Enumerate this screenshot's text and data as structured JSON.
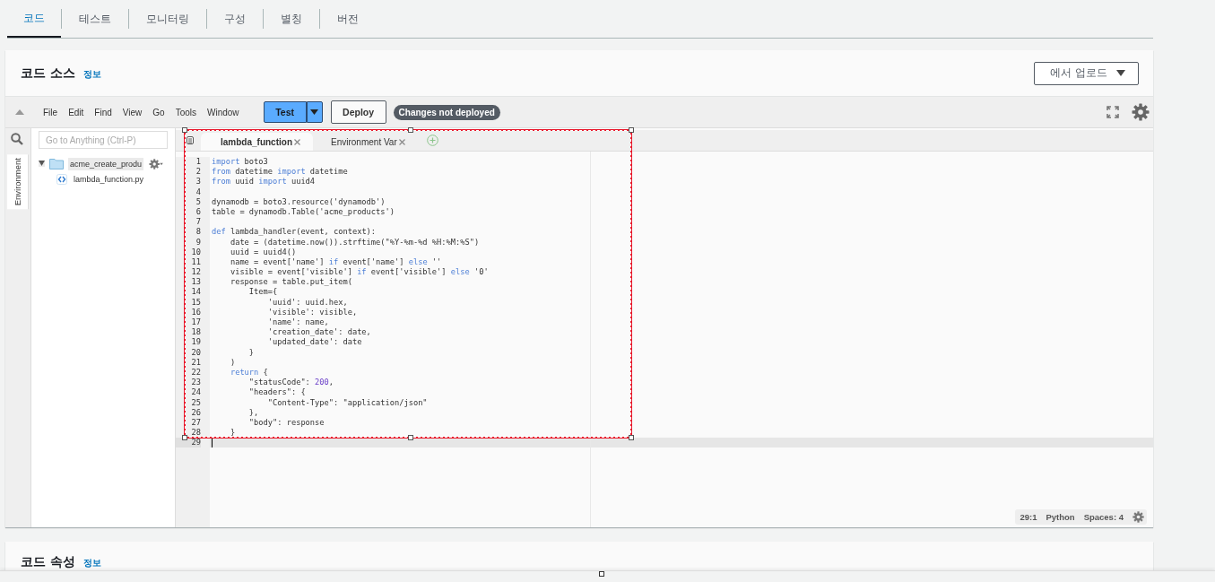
{
  "tabs": [
    {
      "label": "코드",
      "selected": true
    },
    {
      "label": "테스트",
      "selected": false
    },
    {
      "label": "모니터링",
      "selected": false
    },
    {
      "label": "구성",
      "selected": false
    },
    {
      "label": "별칭",
      "selected": false
    },
    {
      "label": "버전",
      "selected": false
    }
  ],
  "code_source": {
    "title": "코드 소스",
    "info_link": "정보",
    "upload_button": "에서 업로드"
  },
  "toolbar": {
    "menu": [
      "File",
      "Edit",
      "Find",
      "View",
      "Go",
      "Tools",
      "Window"
    ],
    "test_button": "Test",
    "deploy_button": "Deploy",
    "status_badge": "Changes not deployed"
  },
  "sidebar": {
    "search": {
      "placeholder": "Go to Anything (Ctrl-P)"
    },
    "side_tab": "Environment",
    "tree": [
      {
        "label": "acme_create_produ",
        "kind": "folder",
        "expanded": true,
        "selected": true,
        "children": [
          {
            "label": "lambda_function.py",
            "kind": "file",
            "selected": false
          }
        ]
      }
    ]
  },
  "editor_tabs": [
    {
      "label": "lambda_function",
      "selected": true
    },
    {
      "label": "Environment Var",
      "selected": false
    }
  ],
  "code_lines": [
    {
      "n": "1",
      "current": false,
      "tokens": [
        {
          "text": "import",
          "kind": "kw"
        },
        {
          "text": " boto3",
          "kind": "plain"
        }
      ]
    },
    {
      "n": "2",
      "current": false,
      "tokens": [
        {
          "text": "from",
          "kind": "kw"
        },
        {
          "text": " datetime ",
          "kind": "plain"
        },
        {
          "text": "import",
          "kind": "kw"
        },
        {
          "text": " datetime",
          "kind": "plain"
        }
      ]
    },
    {
      "n": "3",
      "current": false,
      "tokens": [
        {
          "text": "from",
          "kind": "kw"
        },
        {
          "text": " uuid ",
          "kind": "plain"
        },
        {
          "text": "import",
          "kind": "kw"
        },
        {
          "text": " uuid4",
          "kind": "plain"
        }
      ]
    },
    {
      "n": "4",
      "current": false
    },
    {
      "n": "5",
      "current": false,
      "tokens": [
        {
          "text": "dynamodb = boto3.resource('dynamodb')",
          "kind": "plain"
        }
      ]
    },
    {
      "n": "6",
      "current": false,
      "tokens": [
        {
          "text": "table = dynamodb.Table('acme_products')",
          "kind": "plain"
        }
      ]
    },
    {
      "n": "7",
      "current": false
    },
    {
      "n": "8",
      "current": false,
      "tokens": [
        {
          "text": "def",
          "kind": "kw"
        },
        {
          "text": " lambda_handler(event, context):",
          "kind": "plain"
        }
      ]
    },
    {
      "n": "9",
      "current": false,
      "tokens": [
        {
          "text": "    date = (datetime.now()).strftime(\"%Y-%m-%d %H:%M:%S\")",
          "kind": "plain"
        }
      ]
    },
    {
      "n": "10",
      "current": false,
      "tokens": [
        {
          "text": "    uuid = uuid4()",
          "kind": "plain"
        }
      ]
    },
    {
      "n": "11",
      "current": false,
      "tokens": [
        {
          "text": "    name = event['name'] ",
          "kind": "plain"
        },
        {
          "text": "if",
          "kind": "kw"
        },
        {
          "text": " event['name'] ",
          "kind": "plain"
        },
        {
          "text": "else",
          "kind": "kw"
        },
        {
          "text": " ''",
          "kind": "plain"
        }
      ]
    },
    {
      "n": "12",
      "current": false,
      "tokens": [
        {
          "text": "    visible = event['visible'] ",
          "kind": "plain"
        },
        {
          "text": "if",
          "kind": "kw"
        },
        {
          "text": " event['visible'] ",
          "kind": "plain"
        },
        {
          "text": "else",
          "kind": "kw"
        },
        {
          "text": " '0'",
          "kind": "plain"
        }
      ]
    },
    {
      "n": "13",
      "current": false,
      "tokens": [
        {
          "text": "    response = table.put_item(",
          "kind": "plain"
        }
      ]
    },
    {
      "n": "14",
      "current": false,
      "tokens": [
        {
          "text": "        Item={",
          "kind": "plain"
        }
      ]
    },
    {
      "n": "15",
      "current": false,
      "tokens": [
        {
          "text": "            'uuid': uuid.hex,",
          "kind": "plain"
        }
      ]
    },
    {
      "n": "16",
      "current": false,
      "tokens": [
        {
          "text": "            'visible': visible,",
          "kind": "plain"
        }
      ]
    },
    {
      "n": "17",
      "current": false,
      "tokens": [
        {
          "text": "            'name': name,",
          "kind": "plain"
        }
      ]
    },
    {
      "n": "18",
      "current": false,
      "tokens": [
        {
          "text": "            'creation_date': date,",
          "kind": "plain"
        }
      ]
    },
    {
      "n": "19",
      "current": false,
      "tokens": [
        {
          "text": "            'updated_date': date",
          "kind": "plain"
        }
      ]
    },
    {
      "n": "20",
      "current": false,
      "tokens": [
        {
          "text": "        }",
          "kind": "plain"
        }
      ]
    },
    {
      "n": "21",
      "current": false,
      "tokens": [
        {
          "text": "    )",
          "kind": "plain"
        }
      ]
    },
    {
      "n": "22",
      "current": false,
      "tokens": [
        {
          "text": "    return",
          "kind": "kw"
        },
        {
          "text": " {",
          "kind": "plain"
        }
      ]
    },
    {
      "n": "23",
      "current": false,
      "tokens": [
        {
          "text": "        \"statusCode\": ",
          "kind": "plain"
        },
        {
          "text": "200",
          "kind": "num"
        },
        {
          "text": ",",
          "kind": "plain"
        }
      ]
    },
    {
      "n": "24",
      "current": false,
      "tokens": [
        {
          "text": "        \"headers\": {",
          "kind": "plain"
        }
      ]
    },
    {
      "n": "25",
      "current": false,
      "tokens": [
        {
          "text": "            \"Content-Type\": \"application/json\"",
          "kind": "plain"
        }
      ]
    },
    {
      "n": "26",
      "current": false,
      "tokens": [
        {
          "text": "        },",
          "kind": "plain"
        }
      ]
    },
    {
      "n": "27",
      "current": false,
      "tokens": [
        {
          "text": "        \"body\": response",
          "kind": "plain"
        }
      ]
    },
    {
      "n": "28",
      "current": false,
      "tokens": [
        {
          "text": "    }",
          "kind": "plain"
        }
      ]
    },
    {
      "n": "29",
      "current": true
    }
  ],
  "status_bar": {
    "position": "29:1",
    "language": "Python",
    "indent": "Spaces: 4"
  },
  "code_properties": {
    "title": "코드 속성",
    "info_link": "정보"
  }
}
